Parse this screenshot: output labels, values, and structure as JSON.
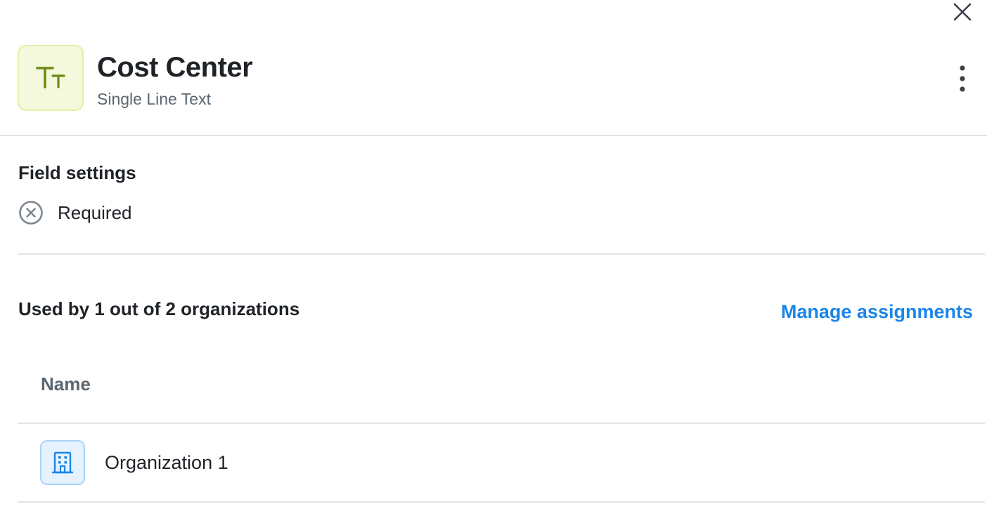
{
  "header": {
    "title": "Cost Center",
    "type": "Single Line Text",
    "type_icon": "text-type-icon",
    "close_icon": "close-icon",
    "more_icon": "more-vertical-icon"
  },
  "settings": {
    "title": "Field settings",
    "required": {
      "label": "Required",
      "state": "off",
      "icon": "x-circle-icon"
    }
  },
  "usage": {
    "title": "Used by 1 out of 2 organizations",
    "manage_label": "Manage assignments",
    "table": {
      "columns": [
        "Name"
      ],
      "rows": [
        {
          "name": "Organization 1",
          "icon": "building-icon"
        }
      ]
    }
  },
  "colors": {
    "accent": "#1a85e8",
    "type_icon_bg": "#f4f8dc",
    "type_icon_fg": "#6b8a12",
    "org_icon_bg": "#e6f2fd",
    "org_icon_fg": "#1a85e8",
    "divider": "#e1e3e6"
  }
}
